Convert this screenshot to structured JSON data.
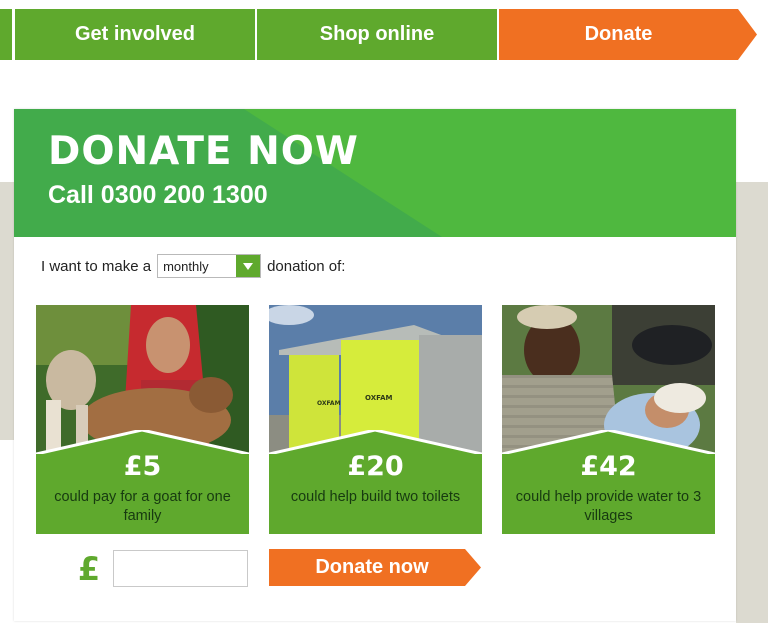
{
  "nav": {
    "items": [
      {
        "label": "Get involved"
      },
      {
        "label": "Shop online"
      },
      {
        "label": "Donate"
      }
    ]
  },
  "hero": {
    "title": "DONATE NOW",
    "phone": "Call 0300 200 1300"
  },
  "donation_form": {
    "prefix": "I want to make a",
    "frequency": {
      "selected": "monthly"
    },
    "suffix": "donation of:"
  },
  "tiles": [
    {
      "amount": "£5",
      "description": "could pay for a goat for one family",
      "image": "girl-with-goat"
    },
    {
      "amount": "£20",
      "description": "could help build two toilets",
      "image": "oxfam-toilets"
    },
    {
      "amount": "£42",
      "description": "could help provide water to 3 villages",
      "image": "mother-and-baby"
    }
  ],
  "custom_amount": {
    "currency_icon": "pound-icon",
    "value": ""
  },
  "donate_button": {
    "label": "Donate now"
  },
  "colors": {
    "green": "#5fa92d",
    "hero_green": "#42ab4b",
    "orange": "#f07022",
    "beige": "#dcdad0"
  }
}
